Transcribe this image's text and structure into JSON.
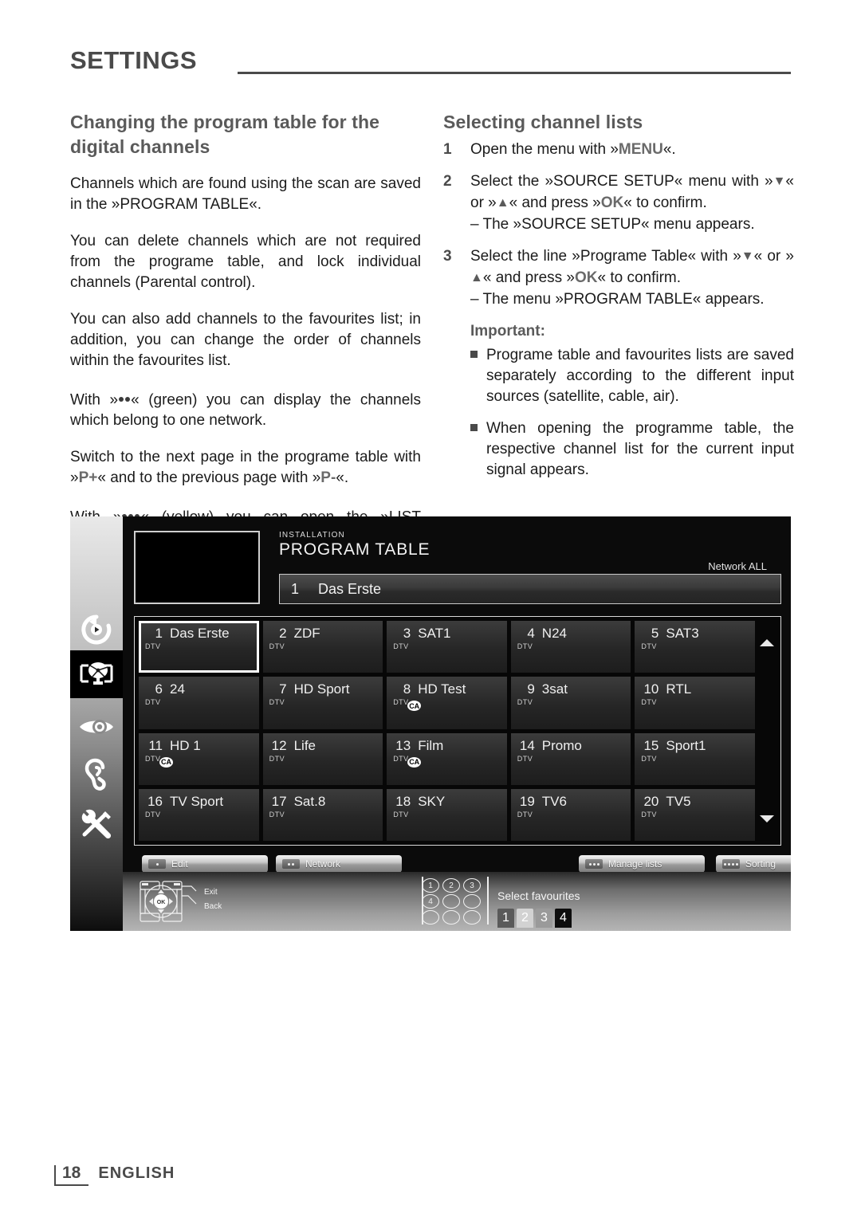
{
  "header": {
    "title": "SETTINGS"
  },
  "left_column": {
    "heading": "Changing the program table for the digital channels",
    "paragraphs": [
      {
        "parts": [
          {
            "t": "text",
            "v": "Channels which are found using the scan are saved in the »PROGRAM TABLE«."
          }
        ]
      },
      {
        "parts": [
          {
            "t": "text",
            "v": "You can delete channels which are not required from the programe table, and lock individual channels (Parental control)."
          }
        ]
      },
      {
        "parts": [
          {
            "t": "text",
            "v": "You can also add channels to the favourites list; in addition, you can change the order of channels within the favourites list."
          }
        ]
      },
      {
        "parts": [
          {
            "t": "text",
            "v": "With »"
          },
          {
            "t": "dots",
            "v": "2"
          },
          {
            "t": "text",
            "v": "« (green) you can display the channels which belong to one network."
          }
        ]
      },
      {
        "parts": [
          {
            "t": "text",
            "v": "Switch to the next page in the programe table with »"
          },
          {
            "t": "kbd",
            "v": "P+"
          },
          {
            "t": "text",
            "v": "« and to the previous page with »"
          },
          {
            "t": "kbd",
            "v": "P-"
          },
          {
            "t": "text",
            "v": "«."
          }
        ]
      },
      {
        "parts": [
          {
            "t": "text",
            "v": "With »"
          },
          {
            "t": "dots",
            "v": "3"
          },
          {
            "t": "text",
            "v": "« (yellow) you can open the »LIST MANAGEMENT« within the programe table."
          }
        ]
      }
    ]
  },
  "right_column": {
    "heading": "Selecting channel lists",
    "steps": [
      {
        "num": "1",
        "parts": [
          {
            "t": "text",
            "v": "Open the menu with »"
          },
          {
            "t": "kbd",
            "v": "MENU"
          },
          {
            "t": "text",
            "v": "«."
          }
        ]
      },
      {
        "num": "2",
        "parts": [
          {
            "t": "text",
            "v": "Select the »SOURCE SETUP« menu with »"
          },
          {
            "t": "arrow",
            "v": "▼"
          },
          {
            "t": "text",
            "v": "« or »"
          },
          {
            "t": "arrow",
            "v": "▲"
          },
          {
            "t": "text",
            "v": "« and press »"
          },
          {
            "t": "kbd",
            "v": "OK"
          },
          {
            "t": "text",
            "v": "« to confirm."
          }
        ],
        "sub": "–  The »SOURCE SETUP« menu appears."
      },
      {
        "num": "3",
        "parts": [
          {
            "t": "text",
            "v": "Select the line »Programe Table« with »"
          },
          {
            "t": "arrow",
            "v": "▼"
          },
          {
            "t": "text",
            "v": "« or »"
          },
          {
            "t": "arrow",
            "v": "▲"
          },
          {
            "t": "text",
            "v": "« and press »"
          },
          {
            "t": "kbd",
            "v": "OK"
          },
          {
            "t": "text",
            "v": "« to confirm."
          }
        ],
        "sub": "–  The menu »PROGRAM TABLE« appears."
      }
    ],
    "important_label": "Important:",
    "bullets": [
      "Programe table and favourites lists are saved separately according to the different input sources (satellite, cable, air).",
      "When opening the programme table, the respective channel list for the current input signal appears."
    ]
  },
  "tv_screenshot": {
    "sidebar_icons": [
      {
        "name": "media-play-icon",
        "selected": false
      },
      {
        "name": "installation-antenna-icon",
        "selected": true
      },
      {
        "name": "picture-eye-icon",
        "selected": false
      },
      {
        "name": "sound-ear-icon",
        "selected": false
      },
      {
        "name": "settings-tools-icon",
        "selected": false
      }
    ],
    "kicker": "INSTALLATION",
    "title": "PROGRAM TABLE",
    "network": "Network ALL",
    "current": {
      "number": "1",
      "name": "Das Erste"
    },
    "channels": [
      {
        "num": "1",
        "name": "Das Erste",
        "tag": "DTV",
        "ca": false,
        "selected": true
      },
      {
        "num": "2",
        "name": "ZDF",
        "tag": "DTV",
        "ca": false,
        "selected": false
      },
      {
        "num": "3",
        "name": "SAT1",
        "tag": "DTV",
        "ca": false,
        "selected": false
      },
      {
        "num": "4",
        "name": "N24",
        "tag": "DTV",
        "ca": false,
        "selected": false
      },
      {
        "num": "5",
        "name": "SAT3",
        "tag": "DTV",
        "ca": false,
        "selected": false
      },
      {
        "num": "6",
        "name": "24",
        "tag": "DTV",
        "ca": false,
        "selected": false
      },
      {
        "num": "7",
        "name": "HD Sport",
        "tag": "DTV",
        "ca": false,
        "selected": false
      },
      {
        "num": "8",
        "name": "HD Test",
        "tag": "DTV",
        "ca": true,
        "selected": false
      },
      {
        "num": "9",
        "name": "3sat",
        "tag": "DTV",
        "ca": false,
        "selected": false
      },
      {
        "num": "10",
        "name": "RTL",
        "tag": "DTV",
        "ca": false,
        "selected": false
      },
      {
        "num": "11",
        "name": "HD 1",
        "tag": "DTV",
        "ca": true,
        "selected": false
      },
      {
        "num": "12",
        "name": "Life",
        "tag": "DTV",
        "ca": false,
        "selected": false
      },
      {
        "num": "13",
        "name": "Film",
        "tag": "DTV",
        "ca": true,
        "selected": false
      },
      {
        "num": "14",
        "name": "Promo",
        "tag": "DTV",
        "ca": false,
        "selected": false
      },
      {
        "num": "15",
        "name": "Sport1",
        "tag": "DTV",
        "ca": false,
        "selected": false
      },
      {
        "num": "16",
        "name": "TV Sport",
        "tag": "DTV",
        "ca": false,
        "selected": false
      },
      {
        "num": "17",
        "name": "Sat.8",
        "tag": "DTV",
        "ca": false,
        "selected": false
      },
      {
        "num": "18",
        "name": "SKY",
        "tag": "DTV",
        "ca": false,
        "selected": false
      },
      {
        "num": "19",
        "name": "TV6",
        "tag": "DTV",
        "ca": false,
        "selected": false
      },
      {
        "num": "20",
        "name": "TV5",
        "tag": "DTV",
        "ca": false,
        "selected": false
      }
    ],
    "ca_label": "CA",
    "toolbar": [
      {
        "label": "Edit",
        "dots": 1
      },
      {
        "label": "Network",
        "dots": 2
      },
      {
        "label": "Manage lists",
        "dots": 3
      },
      {
        "label": "Sorting",
        "dots": 4
      }
    ],
    "remote": {
      "ok": "OK",
      "exit": "Exit",
      "back": "Back"
    },
    "favourites": {
      "label": "Select favourites",
      "keypad": [
        "1",
        "2",
        "3",
        "4",
        "",
        "",
        "",
        "",
        ""
      ],
      "buttons": [
        {
          "label": "1",
          "bg": "#5a5a5a",
          "fg": "#ffffff"
        },
        {
          "label": "2",
          "bg": "#d2d2d2",
          "fg": "#ffffff"
        },
        {
          "label": "3",
          "bg": "#9a9a9a",
          "fg": "#ffffff"
        },
        {
          "label": "4",
          "bg": "#0d0d0d",
          "fg": "#ffffff"
        }
      ]
    }
  },
  "page_footer": {
    "page_number": "18",
    "language": "ENGLISH"
  }
}
